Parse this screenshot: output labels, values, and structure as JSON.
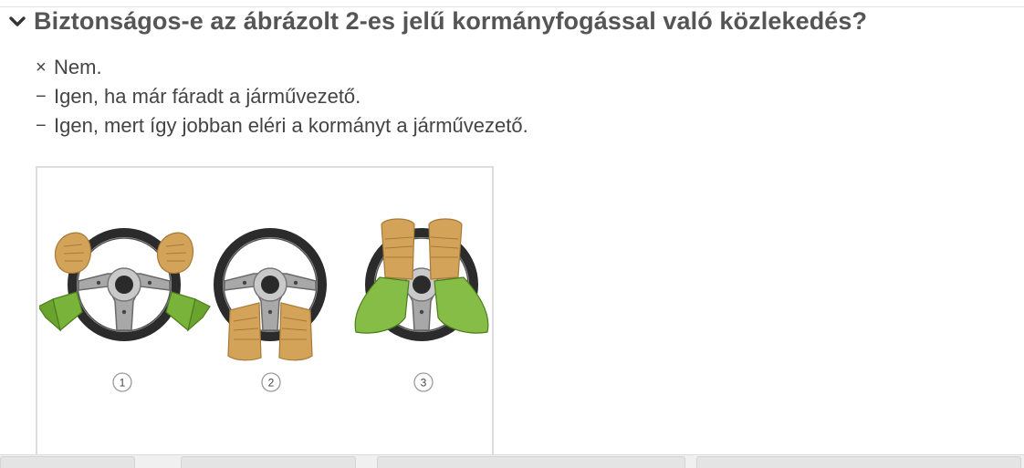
{
  "question": {
    "text": "Biztonságos-e az ábrázolt 2-es jelű kormányfogással való közlekedés?",
    "toggle_icon": "chevron-down-icon"
  },
  "answers": [
    {
      "mark": "×",
      "text": "Nem."
    },
    {
      "mark": "−",
      "text": "Igen, ha már fáradt a járművezető."
    },
    {
      "mark": "−",
      "text": "Igen, mert így jobban eléri a kormányt a járművezető."
    }
  ],
  "figure": {
    "labels": [
      "1",
      "2",
      "3"
    ]
  },
  "colors": {
    "skin": "#d4a35a",
    "sleeve": "#7ab33a",
    "wheel": "#2b2b2b",
    "hub": "#a5a5a5"
  }
}
